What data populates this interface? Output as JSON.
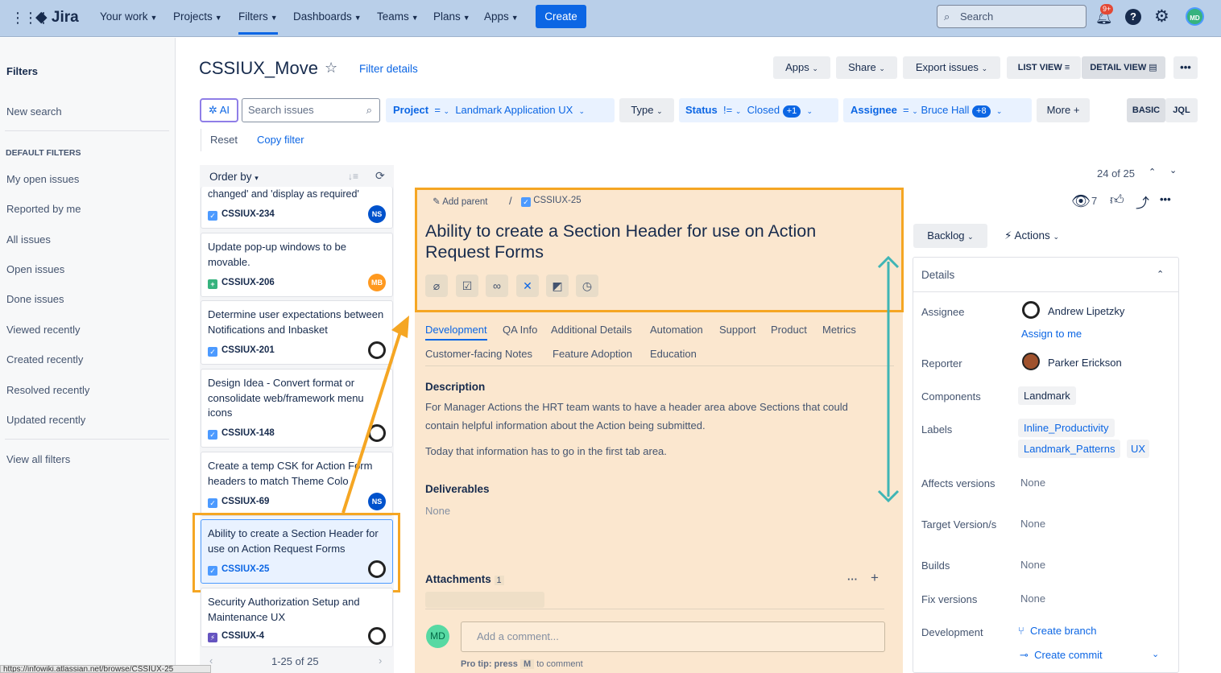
{
  "topnav": {
    "logo": "Jira",
    "items": [
      "Your work",
      "Projects",
      "Filters",
      "Dashboards",
      "Teams",
      "Plans",
      "Apps"
    ],
    "create": "Create",
    "search_placeholder": "Search",
    "notif_badge": "9+",
    "avatar": "MD"
  },
  "sidebar": {
    "title": "Filters",
    "new_search": "New search",
    "section": "DEFAULT FILTERS",
    "items": [
      "My open issues",
      "Reported by me",
      "All issues",
      "Open issues",
      "Done issues",
      "Viewed recently",
      "Created recently",
      "Resolved recently",
      "Updated recently"
    ],
    "view_all": "View all filters"
  },
  "header": {
    "title": "CSSIUX_Move",
    "filter_details": "Filter details",
    "apps": "Apps",
    "share": "Share",
    "export": "Export issues",
    "list_view": "LIST VIEW",
    "detail_view": "DETAIL VIEW"
  },
  "filters": {
    "ai": "AI",
    "search_placeholder": "Search issues",
    "project_label": "Project",
    "project_op": "=",
    "project_val": "Landmark Application UX",
    "type": "Type",
    "status_label": "Status",
    "status_op": "!=",
    "status_val": "Closed",
    "status_badge": "+1",
    "assignee_label": "Assignee",
    "assignee_op": "=",
    "assignee_val": "Bruce Hall",
    "assignee_badge": "+8",
    "more": "More",
    "basic": "BASIC",
    "jql": "JQL",
    "reset": "Reset",
    "copy_filter": "Copy filter"
  },
  "list": {
    "order_by": "Order by",
    "top_partial": "changed' and 'display as required'",
    "cards": [
      {
        "key": "CSSIUX-234",
        "title": "",
        "avatar": "NS"
      },
      {
        "key": "CSSIUX-206",
        "title": "Update pop-up windows to be movable.",
        "avatar": "MB"
      },
      {
        "key": "CSSIUX-201",
        "title": "Determine user expectations between Notifications and Inbasket",
        "avatar": ""
      },
      {
        "key": "CSSIUX-148",
        "title": "Design Idea - Convert format or consolidate web/framework menu icons",
        "avatar": ""
      },
      {
        "key": "CSSIUX-69",
        "title": "Create a temp CSK for Action Form headers to match Theme Colo",
        "avatar": "NS"
      },
      {
        "key": "CSSIUX-25",
        "title": "Ability to create a Section Header for use on Action Request Forms",
        "avatar": ""
      },
      {
        "key": "CSSIUX-4",
        "title": "Security Authorization Setup and Maintenance UX",
        "avatar": ""
      }
    ],
    "pagination": "1-25 of 25",
    "status_url": "https://infowiki.atlassian.net/browse/CSSIUX-25"
  },
  "issue": {
    "add_parent": "Add parent",
    "key": "CSSIUX-25",
    "title": "Ability to create a Section Header for use on Action Request Forms",
    "position": "24 of 25",
    "watchers": "7",
    "tabs": [
      "Development",
      "QA Info",
      "Additional Details",
      "Automation",
      "Support",
      "Product",
      "Metrics",
      "Customer-facing Notes",
      "Feature Adoption",
      "Education"
    ],
    "description_label": "Description",
    "description_1": "For Manager Actions the HRT team wants to have a header area above Sections that could contain helpful information about the Action being submitted.",
    "description_2": "Today that information has to go in the first tab area.",
    "deliverables_label": "Deliverables",
    "deliverables_val": "None",
    "attachments_label": "Attachments",
    "attachments_count": "1",
    "comment_placeholder": "Add a comment...",
    "comment_avatar": "MD",
    "pro_tip": "Pro tip: press",
    "pro_tip_key": "M",
    "pro_tip_end": "to comment"
  },
  "details": {
    "status": "Backlog",
    "actions": "Actions",
    "title": "Details",
    "assignee_label": "Assignee",
    "assignee": "Andrew Lipetzky",
    "assign_me": "Assign to me",
    "reporter_label": "Reporter",
    "reporter": "Parker Erickson",
    "components_label": "Components",
    "components": "Landmark",
    "labels_label": "Labels",
    "labels": [
      "Inline_Productivity",
      "Landmark_Patterns",
      "UX"
    ],
    "affects_label": "Affects versions",
    "affects": "None",
    "target_label": "Target Version/s",
    "target": "None",
    "builds_label": "Builds",
    "builds": "None",
    "fix_label": "Fix versions",
    "fix": "None",
    "dev_label": "Development",
    "create_branch": "Create branch",
    "create_commit": "Create commit"
  },
  "colors": {
    "nav_bg": "#b9cfe9",
    "accent": "#0c66e4",
    "highlight": "#f5a623",
    "issue_bg": "#fbe7cf",
    "teal": "#3fb5b5"
  }
}
